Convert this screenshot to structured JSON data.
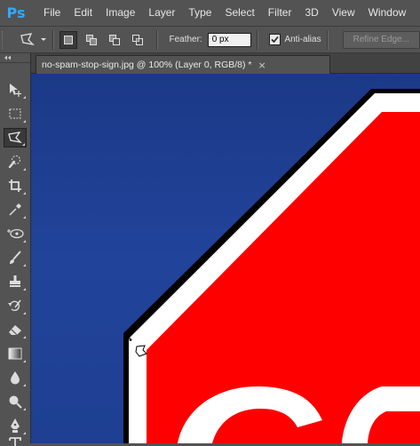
{
  "app": {
    "logo": "Ps"
  },
  "menu": [
    "File",
    "Edit",
    "Image",
    "Layer",
    "Type",
    "Select",
    "Filter",
    "3D",
    "View",
    "Window"
  ],
  "options": {
    "feather_label": "Feather:",
    "feather_value": "0 px",
    "antialias_label": "Anti-alias",
    "antialias_checked": true,
    "refine_label": "Refine Edge..."
  },
  "document": {
    "tab_title": "no-spam-stop-sign.jpg @ 100% (Layer 0, RGB/8) *",
    "close_glyph": "×"
  },
  "tools": [
    "move-tool",
    "rectangular-marquee-tool",
    "polygonal-lasso-tool",
    "quick-selection-tool",
    "crop-tool",
    "eyedropper-tool",
    "spot-healing-brush-tool",
    "brush-tool",
    "clone-stamp-tool",
    "history-brush-tool",
    "eraser-tool",
    "gradient-tool",
    "blur-tool",
    "dodge-tool",
    "pen-tool",
    "type-tool"
  ],
  "active_tool": "polygonal-lasso-tool",
  "colors": {
    "panel": "#535353",
    "canvas_background": "#1d3c8a",
    "sign_red": "#ff0000",
    "sign_white": "#ffffff",
    "sign_outline": "#000000",
    "ps_blue": "#31a8ff"
  }
}
